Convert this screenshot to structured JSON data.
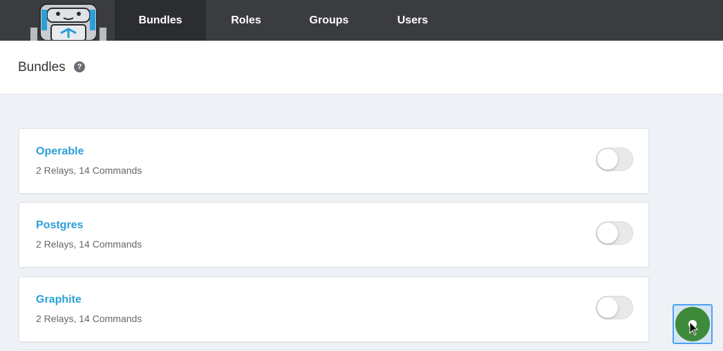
{
  "nav": {
    "items": [
      {
        "label": "Bundles",
        "active": true
      },
      {
        "label": "Roles",
        "active": false
      },
      {
        "label": "Groups",
        "active": false
      },
      {
        "label": "Users",
        "active": false
      }
    ]
  },
  "header": {
    "title": "Bundles",
    "help_icon": "?"
  },
  "bundles": [
    {
      "name": "Operable",
      "meta": "2 Relays, 14 Commands",
      "enabled": false
    },
    {
      "name": "Postgres",
      "meta": "2 Relays, 14 Commands",
      "enabled": false
    },
    {
      "name": "Graphite",
      "meta": "2 Relays, 14 Commands",
      "enabled": false
    }
  ],
  "colors": {
    "nav_bg": "#3a3c40",
    "nav_active_bg": "#2b2d31",
    "link": "#2a9fd8",
    "fab": "#3e8a3a",
    "page_bg": "#eef1f5"
  }
}
